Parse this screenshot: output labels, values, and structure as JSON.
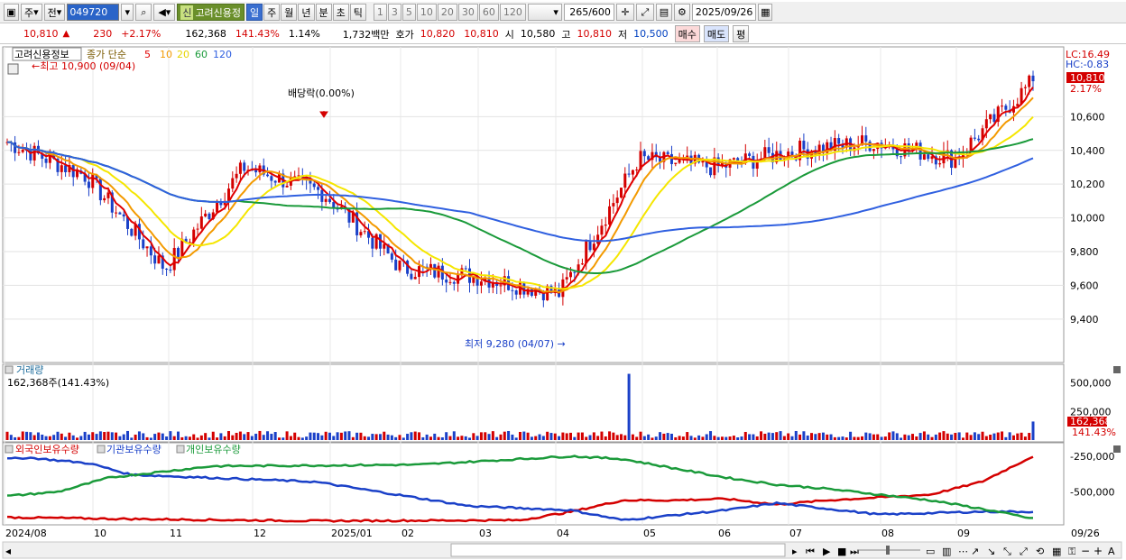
{
  "toolbar": {
    "layout_icon": "window-icon",
    "period_type": "주",
    "all_label": "전",
    "code": "049720",
    "name_badge": "신",
    "stock_name": "고려신용정",
    "periods": [
      "일",
      "주",
      "월",
      "년",
      "분",
      "초",
      "틱"
    ],
    "period_selected": "일",
    "intervals": [
      "1",
      "3",
      "5",
      "10",
      "20",
      "30",
      "60",
      "120"
    ],
    "count": "265",
    "count_max": "/600",
    "date": "2025/09/26"
  },
  "quote": {
    "price": "10,810",
    "arrow": "▲",
    "change": "230",
    "change_pct": "+2.17%",
    "volume": "162,368",
    "volume_pct": "141.43%",
    "turnover": "1.14%",
    "amount": "1,732백만",
    "bid_label": "호가",
    "ask_price": "10,820",
    "bid_price": "10,810",
    "open_label": "시",
    "open": "10,580",
    "high_label": "고",
    "high": "10,810",
    "low_label": "저",
    "low": "10,500",
    "buy_label": "매수",
    "sell_label": "매도",
    "avg_label": "평"
  },
  "colors": {
    "up": "#d40000",
    "down": "#1a40c8",
    "ma5": "#e00000",
    "ma10": "#f39a00",
    "ma20": "#f5e600",
    "ma60": "#1a9a3a",
    "ma120": "#3060e0"
  },
  "price_panel": {
    "title": "고려신용정보",
    "ma_label": "종가 단순",
    "ma_periods": [
      "5",
      "10",
      "20",
      "60",
      "120"
    ],
    "high_annot": "←최고 10,900 (09/04)",
    "low_annot": "최저 9,280 (04/07) →",
    "dividend_annot": "배당락(0.00%)",
    "lc": "LC:16.49",
    "hc": "HC:-0.83",
    "current_price": "10,810",
    "current_pct": "2.17%"
  },
  "volume_panel": {
    "title": "거래량",
    "info": "162,368주(141.43%)",
    "current": "162,368",
    "current_pct": "141.43%"
  },
  "holding_panel": {
    "legend": [
      "외국인보유수량",
      "기관보유수량",
      "개인보유수량"
    ]
  },
  "x_labels": [
    "2024/08",
    "10",
    "11",
    "12",
    "2025/01",
    "02",
    "03",
    "04",
    "05",
    "06",
    "07",
    "08",
    "09",
    "09/26"
  ],
  "chart_data": [
    {
      "type": "candlestick",
      "title": "고려신용정보",
      "y_ticks": [
        9400,
        9600,
        9800,
        10000,
        10200,
        10400,
        10600
      ],
      "ylim": [
        9180,
        10960
      ],
      "months": [
        "2024/08",
        "10",
        "11",
        "12",
        "2025/01",
        "02",
        "03",
        "04",
        "05",
        "06",
        "07",
        "08",
        "09"
      ],
      "approx_close": [
        10450,
        10250,
        9700,
        10300,
        10150,
        9700,
        9650,
        9550,
        10350,
        10300,
        10400,
        10450,
        10350,
        10810
      ],
      "annotations": {
        "max": 10900,
        "max_date": "09/04",
        "min": 9280,
        "min_date": "04/07"
      },
      "last": {
        "open": 10580,
        "high": 10810,
        "low": 10500,
        "close": 10810
      }
    },
    {
      "type": "bar",
      "title": "거래량",
      "y_ticks": [
        250000,
        500000
      ],
      "last_value": 162368
    },
    {
      "type": "line",
      "series": [
        {
          "name": "외국인보유수량"
        },
        {
          "name": "기관보유수량"
        },
        {
          "name": "개인보유수량"
        }
      ],
      "y_ticks": [
        -250000,
        -500000
      ]
    }
  ]
}
